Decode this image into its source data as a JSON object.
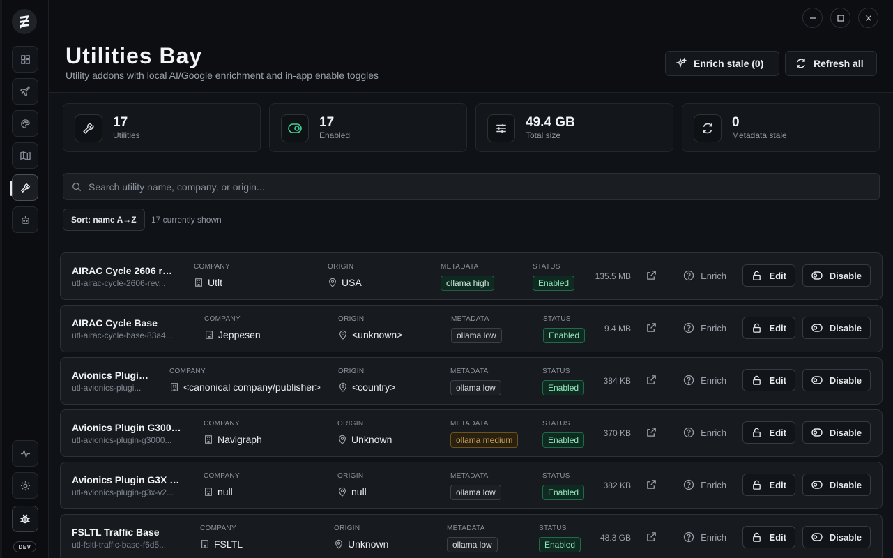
{
  "app": {
    "title": "Utilities Bay",
    "subtitle": "Utility addons with local AI/Google enrichment and in-app enable toggles",
    "dev_badge": "DEV"
  },
  "header_actions": {
    "enrich_stale": "Enrich stale (0)",
    "refresh_all": "Refresh all"
  },
  "stats": [
    {
      "value": "17",
      "label": "Utilities",
      "icon": "wrench-icon"
    },
    {
      "value": "17",
      "label": "Enabled",
      "icon": "toggle-icon"
    },
    {
      "value": "49.4 GB",
      "label": "Total size",
      "icon": "sliders-icon"
    },
    {
      "value": "0",
      "label": "Metadata stale",
      "icon": "refresh-icon"
    }
  ],
  "search": {
    "placeholder": "Search utility name, company, or origin..."
  },
  "sort": {
    "label": "Sort: name A→Z",
    "count_note": "17 currently shown"
  },
  "columns": {
    "company": "COMPANY",
    "origin": "ORIGIN",
    "metadata": "METADATA",
    "status": "STATUS"
  },
  "row_actions": {
    "enrich": "Enrich",
    "edit": "Edit",
    "disable": "Disable"
  },
  "rows": [
    {
      "name": "AIRAC Cycle 2606 re...",
      "id": "utl-airac-cycle-2606-rev...",
      "company": "Utlt",
      "origin": "USA",
      "metadata": "ollama high",
      "status": "Enabled",
      "size": "135.5 MB"
    },
    {
      "name": "AIRAC Cycle Base",
      "id": "utl-airac-cycle-base-83a4...",
      "company": "Jeppesen",
      "origin": "<unknown>",
      "metadata": "ollama low",
      "status": "Enabled",
      "size": "9.4 MB"
    },
    {
      "name": "Avionics Plugin...",
      "id": "utl-avionics-plugi...",
      "company": "<canonical company/publisher>",
      "origin": "<country>",
      "metadata": "ollama low",
      "status": "Enabled",
      "size": "384 KB"
    },
    {
      "name": "Avionics Plugin G3000...",
      "id": "utl-avionics-plugin-g3000...",
      "company": "Navigraph",
      "origin": "Unknown",
      "metadata": "ollama medium",
      "status": "Enabled",
      "size": "370 KB"
    },
    {
      "name": "Avionics Plugin G3X v2...",
      "id": "utl-avionics-plugin-g3x-v2...",
      "company": "null",
      "origin": "null",
      "metadata": "ollama low",
      "status": "Enabled",
      "size": "382 KB"
    },
    {
      "name": "FSLTL Traffic Base",
      "id": "utl-fsltl-traffic-base-f6d5...",
      "company": "FSLTL",
      "origin": "Unknown",
      "metadata": "ollama low",
      "status": "Enabled",
      "size": "48.3 GB"
    }
  ]
}
